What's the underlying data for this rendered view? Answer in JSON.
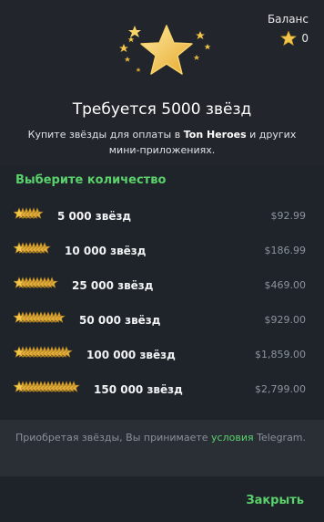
{
  "balance": {
    "label": "Баланс",
    "value": "0",
    "icon": "star-icon"
  },
  "header": {
    "title": "Требуется 5000 звёзд",
    "subtitle_pre": "Купите звёзды для оплаты в ",
    "subtitle_app": "Ton Heroes",
    "subtitle_post": " и других мини-приложениях."
  },
  "options_section": {
    "title": "Выберите количество",
    "options": [
      {
        "label": "5 000 звёзд",
        "price": "$92.99",
        "stack_size": 1
      },
      {
        "label": "10 000 звёзд",
        "price": "$186.99",
        "stack_size": 2
      },
      {
        "label": "25 000 звёзд",
        "price": "$469.00",
        "stack_size": 3
      },
      {
        "label": "50 000 звёзд",
        "price": "$929.00",
        "stack_size": 4
      },
      {
        "label": "100 000 звёзд",
        "price": "$1,859.00",
        "stack_size": 5
      },
      {
        "label": "150 000 звёзд",
        "price": "$2,799.00",
        "stack_size": 6
      }
    ]
  },
  "footer": {
    "terms_pre": "Приобретая звёзды, Вы принимаете ",
    "terms_link": "условия",
    "terms_post": " Telegram."
  },
  "close_button": "Закрыть",
  "colors": {
    "accent": "#5ad16b",
    "star": "#f3c54a"
  }
}
